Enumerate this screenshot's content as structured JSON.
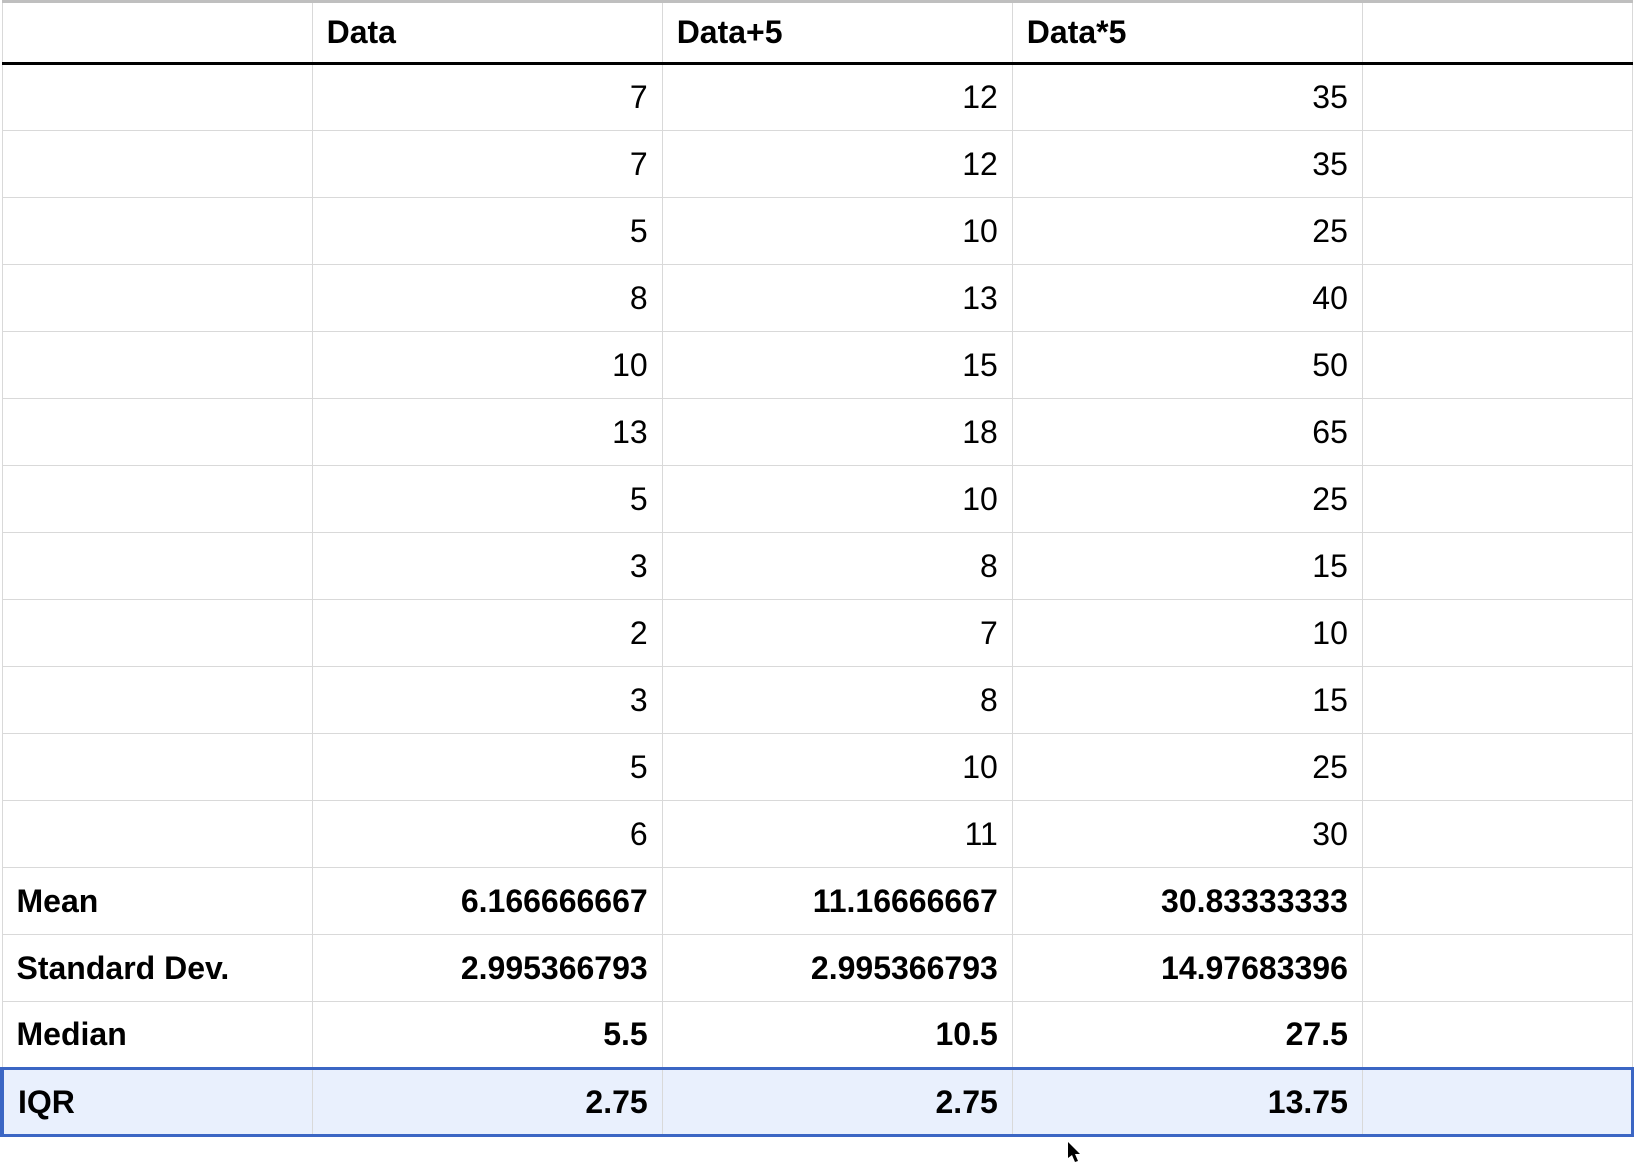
{
  "chart_data": {
    "type": "table",
    "columns": [
      "",
      "Data",
      "Data+5",
      "Data*5"
    ],
    "rows": [
      [
        "",
        7,
        12,
        35
      ],
      [
        "",
        7,
        12,
        35
      ],
      [
        "",
        5,
        10,
        25
      ],
      [
        "",
        8,
        13,
        40
      ],
      [
        "",
        10,
        15,
        50
      ],
      [
        "",
        13,
        18,
        65
      ],
      [
        "",
        5,
        10,
        25
      ],
      [
        "",
        3,
        8,
        15
      ],
      [
        "",
        2,
        7,
        10
      ],
      [
        "",
        3,
        8,
        15
      ],
      [
        "",
        5,
        10,
        25
      ],
      [
        "",
        6,
        11,
        30
      ]
    ],
    "summary": [
      {
        "label": "Mean",
        "values": [
          "6.166666667",
          "11.16666667",
          "30.83333333"
        ]
      },
      {
        "label": "Standard Dev.",
        "values": [
          "2.995366793",
          "2.995366793",
          "14.97683396"
        ]
      },
      {
        "label": "Median",
        "values": [
          "5.5",
          "10.5",
          "27.5"
        ]
      },
      {
        "label": "IQR",
        "values": [
          "2.75",
          "2.75",
          "13.75"
        ],
        "selected": true
      }
    ]
  },
  "headers": {
    "c0": "",
    "c1": "Data",
    "c2": "Data+5",
    "c3": "Data*5"
  },
  "rows": {
    "0": {
      "c0": "",
      "c1": "7",
      "c2": "12",
      "c3": "35"
    },
    "1": {
      "c0": "",
      "c1": "7",
      "c2": "12",
      "c3": "35"
    },
    "2": {
      "c0": "",
      "c1": "5",
      "c2": "10",
      "c3": "25"
    },
    "3": {
      "c0": "",
      "c1": "8",
      "c2": "13",
      "c3": "40"
    },
    "4": {
      "c0": "",
      "c1": "10",
      "c2": "15",
      "c3": "50"
    },
    "5": {
      "c0": "",
      "c1": "13",
      "c2": "18",
      "c3": "65"
    },
    "6": {
      "c0": "",
      "c1": "5",
      "c2": "10",
      "c3": "25"
    },
    "7": {
      "c0": "",
      "c1": "3",
      "c2": "8",
      "c3": "15"
    },
    "8": {
      "c0": "",
      "c1": "2",
      "c2": "7",
      "c3": "10"
    },
    "9": {
      "c0": "",
      "c1": "3",
      "c2": "8",
      "c3": "15"
    },
    "10": {
      "c0": "",
      "c1": "5",
      "c2": "10",
      "c3": "25"
    },
    "11": {
      "c0": "",
      "c1": "6",
      "c2": "11",
      "c3": "30"
    }
  },
  "summary": {
    "mean": {
      "label": "Mean",
      "c1": "6.166666667",
      "c2": "11.16666667",
      "c3": "30.83333333"
    },
    "stddev": {
      "label": "Standard Dev.",
      "c1": "2.995366793",
      "c2": "2.995366793",
      "c3": "14.97683396"
    },
    "median": {
      "label": "Median",
      "c1": "5.5",
      "c2": "10.5",
      "c3": "27.5"
    },
    "iqr": {
      "label": "IQR",
      "c1": "2.75",
      "c2": "2.75",
      "c3": "13.75"
    }
  }
}
